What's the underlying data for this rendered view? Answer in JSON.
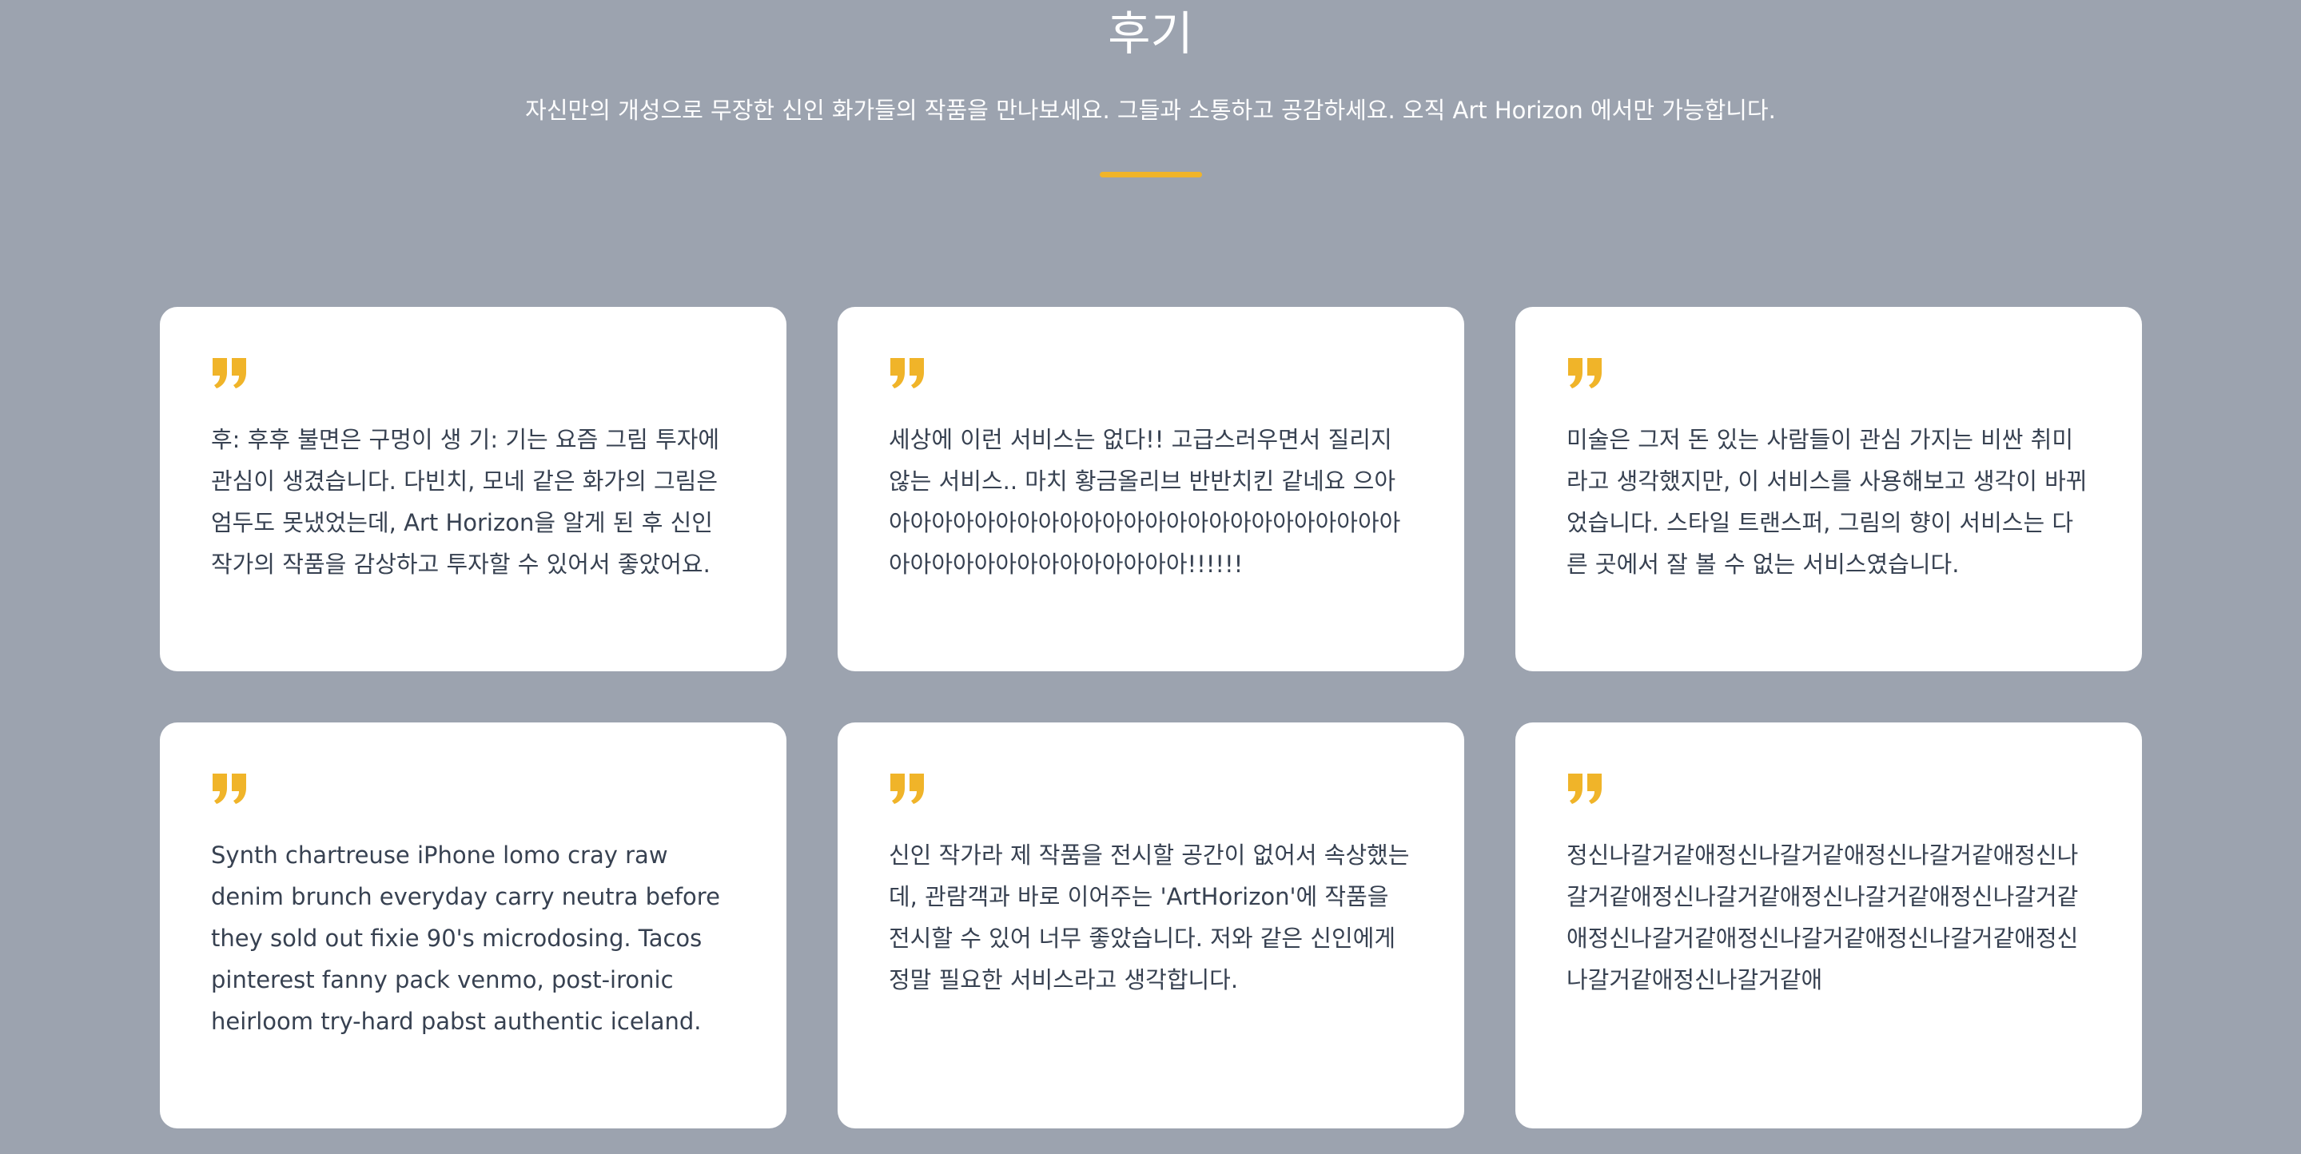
{
  "section": {
    "title": "후기",
    "subtitle": "자신만의 개성으로 무장한 신인 화가들의 작품을 만나보세요. 그들과 소통하고 공감하세요. 오직 Art Horizon 에서만 가능합니다.",
    "accent_color": "#f0b429"
  },
  "testimonials": [
    {
      "icon": "quote-icon",
      "text": "후: 후후 불면은 구멍이 생 기: 기는 요즘 그림 투자에 관심이 생겼습니다. 다빈치, 모네 같은 화가의 그림은 엄두도 못냈었는데, Art Horizon을 알게 된 후 신인 작가의 작품을 감상하고 투자할 수 있어서 좋았어요."
    },
    {
      "icon": "quote-icon",
      "text": "세상에 이런 서비스는 없다!! 고급스러우면서 질리지 않는 서비스.. 마치 황금올리브 반반치킨 같네요 으아아아아아아아아아아아아아아아아아아아아아아아아아아아아아아아아아아아아아아아!!!!!!"
    },
    {
      "icon": "quote-icon",
      "text": "미술은 그저 돈 있는 사람들이 관심 가지는 비싼 취미라고 생각했지만, 이 서비스를 사용해보고 생각이 바뀌었습니다. 스타일 트랜스퍼, 그림의 향이 서비스는 다른 곳에서 잘 볼 수 없는 서비스였습니다."
    },
    {
      "icon": "quote-icon",
      "text": "Synth chartreuse iPhone lomo cray raw denim brunch everyday carry neutra before they sold out fixie 90's microdosing. Tacos pinterest fanny pack venmo, post-ironic heirloom try-hard pabst authentic iceland."
    },
    {
      "icon": "quote-icon",
      "text": "신인 작가라 제 작품을 전시할 공간이 없어서 속상했는데, 관람객과 바로 이어주는 'ArtHorizon'에 작품을 전시할 수 있어 너무 좋았습니다. 저와 같은 신인에게 정말 필요한 서비스라고 생각합니다."
    },
    {
      "icon": "quote-icon",
      "text": "정신나갈거같애정신나갈거같애정신나갈거같애정신나갈거같애정신나갈거같애정신나갈거같애정신나갈거같애정신나갈거같애정신나갈거같애정신나갈거같애정신나갈거같애정신나갈거같애"
    }
  ]
}
